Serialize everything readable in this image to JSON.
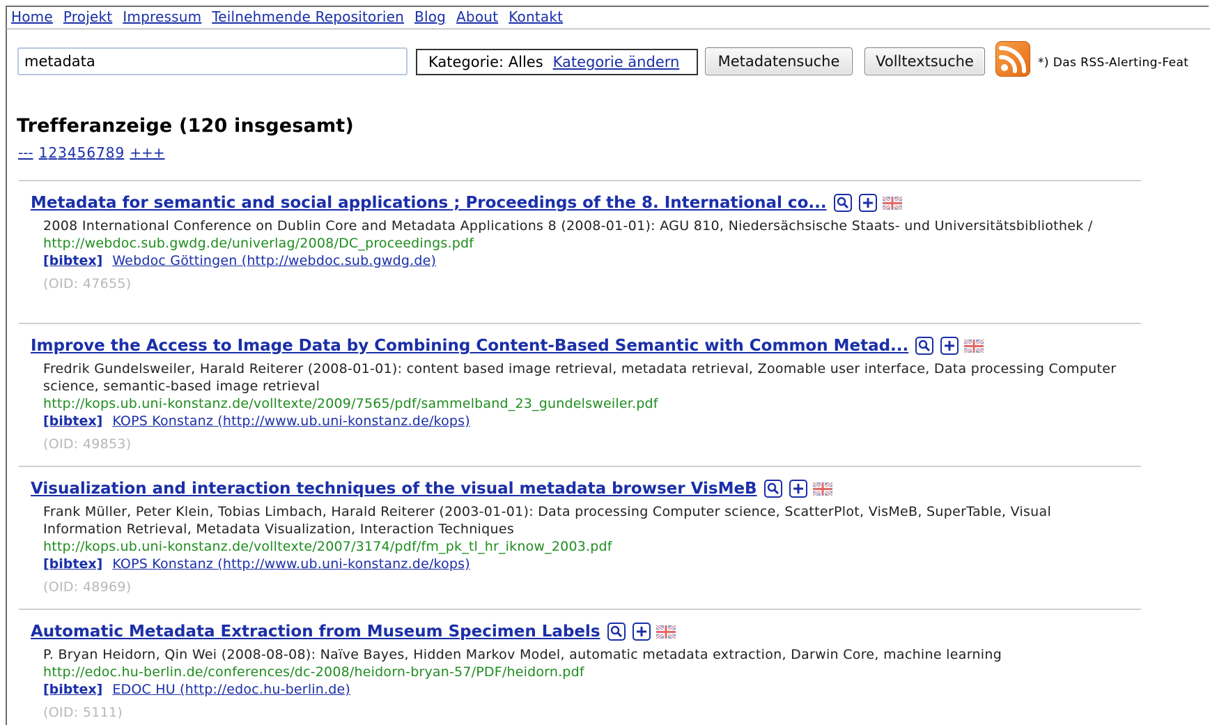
{
  "nav": {
    "items": [
      "Home",
      "Projekt",
      "Impressum",
      "Teilnehmende Repositorien",
      "Blog",
      "About",
      "Kontakt"
    ]
  },
  "search": {
    "query": "metadata",
    "category_prefix": "Kategorie: Alles",
    "category_change_link": "Kategorie ändern",
    "metadata_search_button": "Metadatensuche",
    "fulltext_search_button": "Volltextsuche",
    "rss_note": "*) Das RSS-Alerting-Feat"
  },
  "results": {
    "heading": "Trefferanzeige (120 insgesamt)",
    "pagination": {
      "prev": "---",
      "pages": [
        "1",
        "2",
        "3",
        "4",
        "5",
        "6",
        "7",
        "8",
        "9"
      ],
      "next": "+++"
    },
    "items": [
      {
        "title": "Metadata for semantic and social applications ; Proceedings of the 8. International co...",
        "authors": "2008 International Conference on Dublin Core and Metadata Applications 8 (2008-01-01): AGU 810, Niedersächsische Staats- und Universitätsbibliothek /",
        "url": "http://webdoc.sub.gwdg.de/univerlag/2008/DC_proceedings.pdf",
        "bibtex": "[bibtex]",
        "repository": "Webdoc Göttingen (http://webdoc.sub.gwdg.de)",
        "oid": "(OID: 47655)"
      },
      {
        "title": "Improve the Access to Image Data by Combining Content-Based Semantic with Common Metad...",
        "authors": "Fredrik Gundelsweiler, Harald Reiterer (2008-01-01): content based image retrieval, metadata retrieval, Zoomable user interface, Data processing Computer science, semantic-based image retrieval",
        "url": "http://kops.ub.uni-konstanz.de/volltexte/2009/7565/pdf/sammelband_23_gundelsweiler.pdf",
        "bibtex": "[bibtex]",
        "repository": "KOPS Konstanz (http://www.ub.uni-konstanz.de/kops)",
        "oid": "(OID: 49853)"
      },
      {
        "title": "Visualization and interaction techniques of the visual metadata browser VisMeB",
        "authors": "Frank Müller, Peter Klein, Tobias Limbach, Harald Reiterer (2003-01-01): Data processing Computer science, ScatterPlot, VisMeB, SuperTable, Visual Information Retrieval, Metadata Visualization, Interaction Techniques",
        "url": "http://kops.ub.uni-konstanz.de/volltexte/2007/3174/pdf/fm_pk_tl_hr_iknow_2003.pdf",
        "bibtex": "[bibtex]",
        "repository": "KOPS Konstanz (http://www.ub.uni-konstanz.de/kops)",
        "oid": "(OID: 48969)"
      },
      {
        "title": "Automatic Metadata Extraction from Museum Specimen Labels",
        "authors": "P. Bryan Heidorn, Qin Wei (2008-08-08): Naïve Bayes, Hidden Markov Model, automatic metadata extraction, Darwin Core, machine learning",
        "url": "http://edoc.hu-berlin.de/conferences/dc-2008/heidorn-bryan-57/PDF/heidorn.pdf",
        "bibtex": "[bibtex]",
        "repository": "EDOC HU (http://edoc.hu-berlin.de)",
        "oid": "(OID: 5111)"
      }
    ]
  },
  "icons": {
    "detail": "magnifier-icon",
    "add": "plus-icon",
    "language": "uk-flag-icon",
    "feed": "rss-icon"
  }
}
